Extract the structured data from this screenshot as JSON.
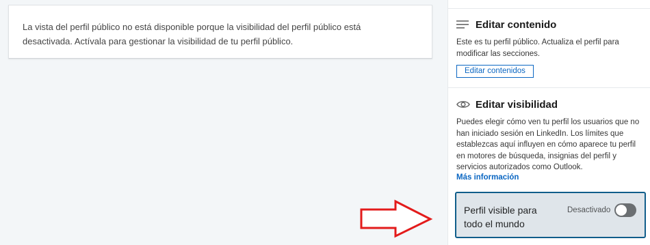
{
  "main": {
    "message": "La vista del perfil público no está disponible porque la visibilidad del perfil público está desactivada. Actívala para gestionar la visibilidad de tu perfil público."
  },
  "sidebar": {
    "edit_content": {
      "icon": "lines-icon",
      "title": "Editar contenido",
      "description": "Este es tu perfil público. Actualiza el perfil para modificar las secciones.",
      "button_label": "Editar contenidos"
    },
    "edit_visibility": {
      "icon": "eye-icon",
      "title": "Editar visibilidad",
      "description": "Puedes elegir cómo ven tu perfil los usuarios que no han iniciado sesión en LinkedIn. Los límites que establezcas aquí influyen en cómo aparece tu perfil en motores de búsqueda, insignias del perfil y servicios autorizados como Outlook.",
      "more_link": "Más información"
    },
    "public_visibility": {
      "label": "Perfil visible para todo el mundo",
      "toggle_state": "Desactivado",
      "enabled": false
    }
  },
  "colors": {
    "accent": "#0a66c2",
    "panel_border": "#0f5d8a",
    "annotation_arrow": "#e31b1b"
  }
}
